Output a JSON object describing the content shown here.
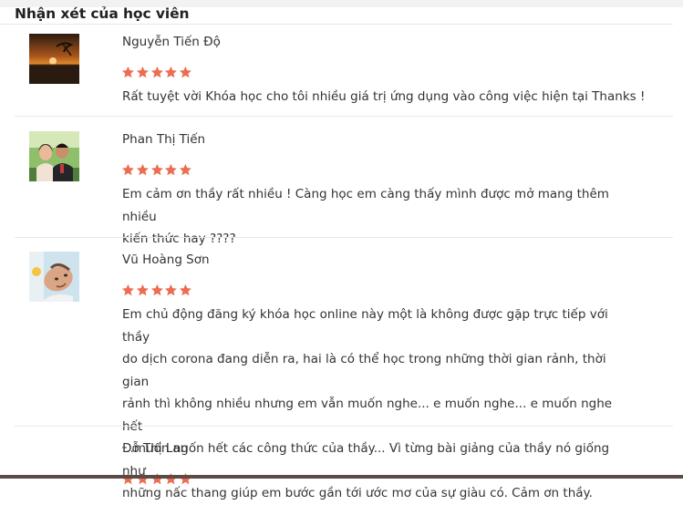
{
  "section_title": "Nhận xét của học viên",
  "star_color": "#ec6d51",
  "reviews": [
    {
      "name": "Nguyễn Tiến Độ",
      "rating": 5,
      "avatar_icon": "sunset-photo-avatar",
      "comment": "Rất tuyệt vời Khóa học cho tôi nhiều giá trị ứng dụng vào công việc hiện tại Thanks !"
    },
    {
      "name": "Phan Thị Tiến",
      "rating": 5,
      "avatar_icon": "couple-photo-avatar",
      "comment_lines": [
        "Em cảm ơn thầy rất nhiều ! Càng học em càng thấy mình được mở mang thêm nhiều",
        "kiến thức hay ????"
      ]
    },
    {
      "name": "Vũ Hoàng Sơn",
      "rating": 5,
      "avatar_icon": "man-photo-avatar",
      "comment_lines": [
        "Em chủ động đăng ký khóa học online này một là không được gặp trực tiếp với thầy",
        "do dịch corona đang diễn ra, hai là có thể học trong những thời gian rảnh, thời gian",
        "rảnh thì không nhiều nhưng em vẫn muốn nghe... e muốn nghe... e muốn nghe hết",
        "...muốn ngốn hết các công thức của thầy... Vì từng bài giảng của thầy nó giống như",
        "những nấc thang giúp em bước gần tới ước mơ của sự giàu có. Cảm ơn thầy."
      ]
    },
    {
      "name": "Đỗ Thị Lan",
      "rating": 5
    }
  ]
}
